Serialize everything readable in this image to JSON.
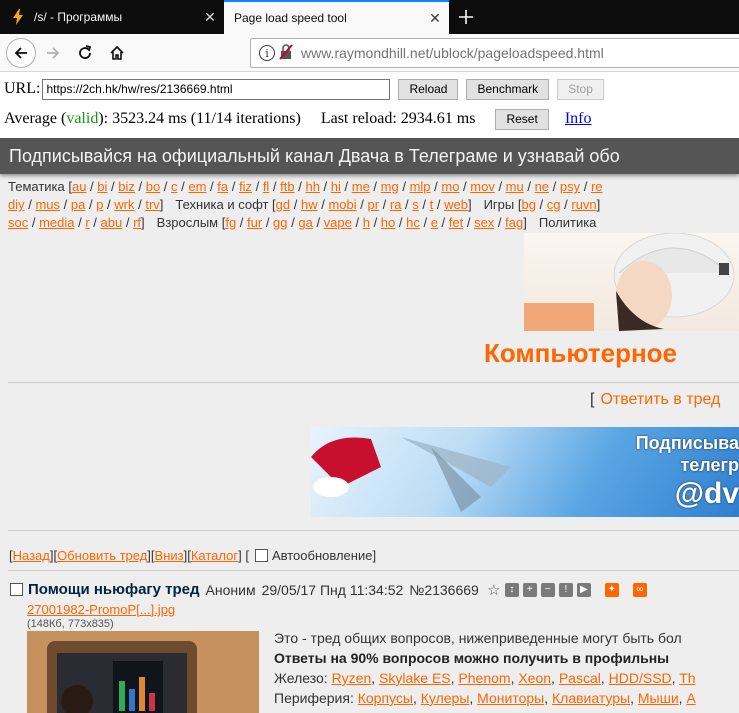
{
  "browser": {
    "tabs": [
      {
        "title": "/s/ - Программы",
        "icon": "lightning-icon",
        "active": false
      },
      {
        "title": "Page load speed tool",
        "icon": "",
        "active": true
      }
    ],
    "url_host": "www.raymondhill.net",
    "url_path": "/ublock/pageloadspeed.html",
    "accent": "#0a84ff"
  },
  "tool": {
    "url_label": "URL:",
    "url_value": "https://2ch.hk/hw/res/2136669.html",
    "reload_label": "Reload",
    "benchmark_label": "Benchmark",
    "stop_label": "Stop",
    "average_prefix": "Average (",
    "average_valid": "valid",
    "average_suffix": "): 3523.24 ms (11/14 iterations)",
    "last_reload": "Last reload: 2934.61 ms",
    "reset_label": "Reset",
    "info_label": "Info"
  },
  "site": {
    "banner_text": "Подписывайся на официальный канал Двача в Телеграме и узнавай обо",
    "board_lines": [
      {
        "groups": [
          {
            "label": "Тематика",
            "boards": [
              "au",
              "bi",
              "biz",
              "bo",
              "c",
              "em",
              "fa",
              "fiz",
              "fl",
              "ftb",
              "hh",
              "hi",
              "me",
              "mg",
              "mlp",
              "mo",
              "mov",
              "mu",
              "ne",
              "psy",
              "re"
            ]
          }
        ]
      },
      {
        "groups": [
          {
            "label": "",
            "boards": [
              "diy",
              "mus",
              "pa",
              "p",
              "wrk",
              "trv"
            ]
          },
          {
            "label": "Техника и софт",
            "boards": [
              "gd",
              "hw",
              "mobi",
              "pr",
              "ra",
              "s",
              "t",
              "web"
            ]
          },
          {
            "label": "Игры",
            "boards": [
              "bg",
              "cg",
              "ruvn"
            ]
          }
        ]
      },
      {
        "groups": [
          {
            "label": "",
            "boards": [
              "soc",
              "media",
              "r",
              "abu",
              "rf"
            ]
          },
          {
            "label": "Взрослым",
            "boards": [
              "fg",
              "fur",
              "gg",
              "ga",
              "vape",
              "h",
              "ho",
              "hc",
              "e",
              "fet",
              "sex",
              "fag"
            ]
          },
          {
            "label": "Политика",
            "boards": []
          }
        ]
      }
    ],
    "board_title": "Компьютерное",
    "reply_link": "Ответить в тред",
    "ad_lines": [
      "Подписыва",
      "телегр",
      "@dv"
    ],
    "nav": {
      "back": "Назад",
      "refresh": "Обновить тред",
      "down": "Вниз",
      "catalog": "Каталог",
      "autoupdate": "Автообновление"
    },
    "post": {
      "subject": "Помощи ньюфагу тред",
      "author": "Аноним",
      "date": "29/05/17 Пнд 11:34:52",
      "number": "№2136669",
      "file_name": "27001982-PromoP[...].jpg",
      "file_info": "(148Кб, 773x835)",
      "body_line1": "Это - тред общих вопросов, нижеприведенные могут быть бол",
      "body_line2": "Ответы на 90% вопросов можно получить в профильны",
      "body_line3_label": "Железо:",
      "body_line3_links": [
        "Ryzen",
        "Skylake ES",
        "Phenom",
        "Xeon",
        "Pascal",
        "HDD/SSD",
        "Th"
      ],
      "body_line4_label": "Периферия:",
      "body_line4_links": [
        "Корпусы",
        "Кулеры",
        "Мониторы",
        "Клавиатуры",
        "Мыши",
        "А"
      ]
    },
    "link_color": "#ff6600"
  }
}
